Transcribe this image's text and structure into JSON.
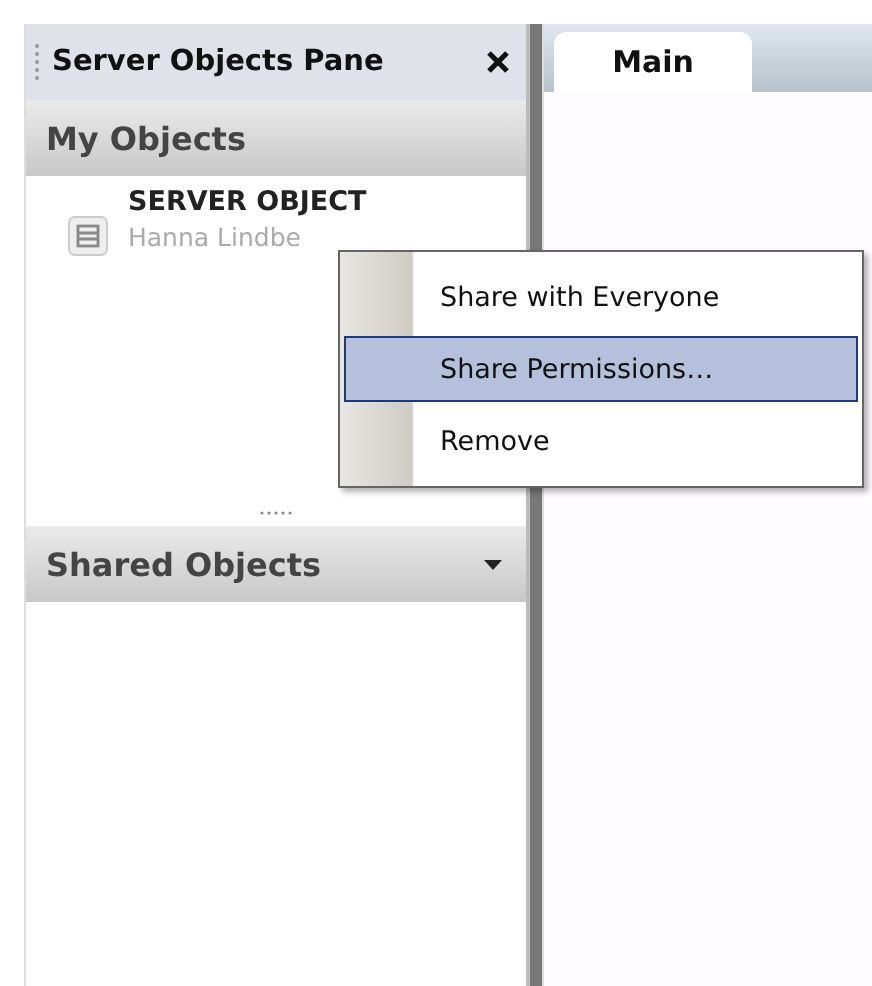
{
  "pane": {
    "title": "Server Objects Pane",
    "sections": [
      {
        "title": "My Objects",
        "collapsible": false,
        "items": [
          {
            "name": "SERVER OBJECT",
            "owner": "Hanna Lindbe"
          }
        ]
      },
      {
        "title": "Shared Objects",
        "collapsible": true
      }
    ]
  },
  "tabs": [
    {
      "label": "Main",
      "selected": true
    }
  ],
  "context_menu": {
    "items": [
      {
        "label": "Share with Everyone",
        "selected": false
      },
      {
        "label": "Share Permissions…",
        "selected": true
      },
      {
        "label": "Remove",
        "selected": false
      }
    ]
  }
}
